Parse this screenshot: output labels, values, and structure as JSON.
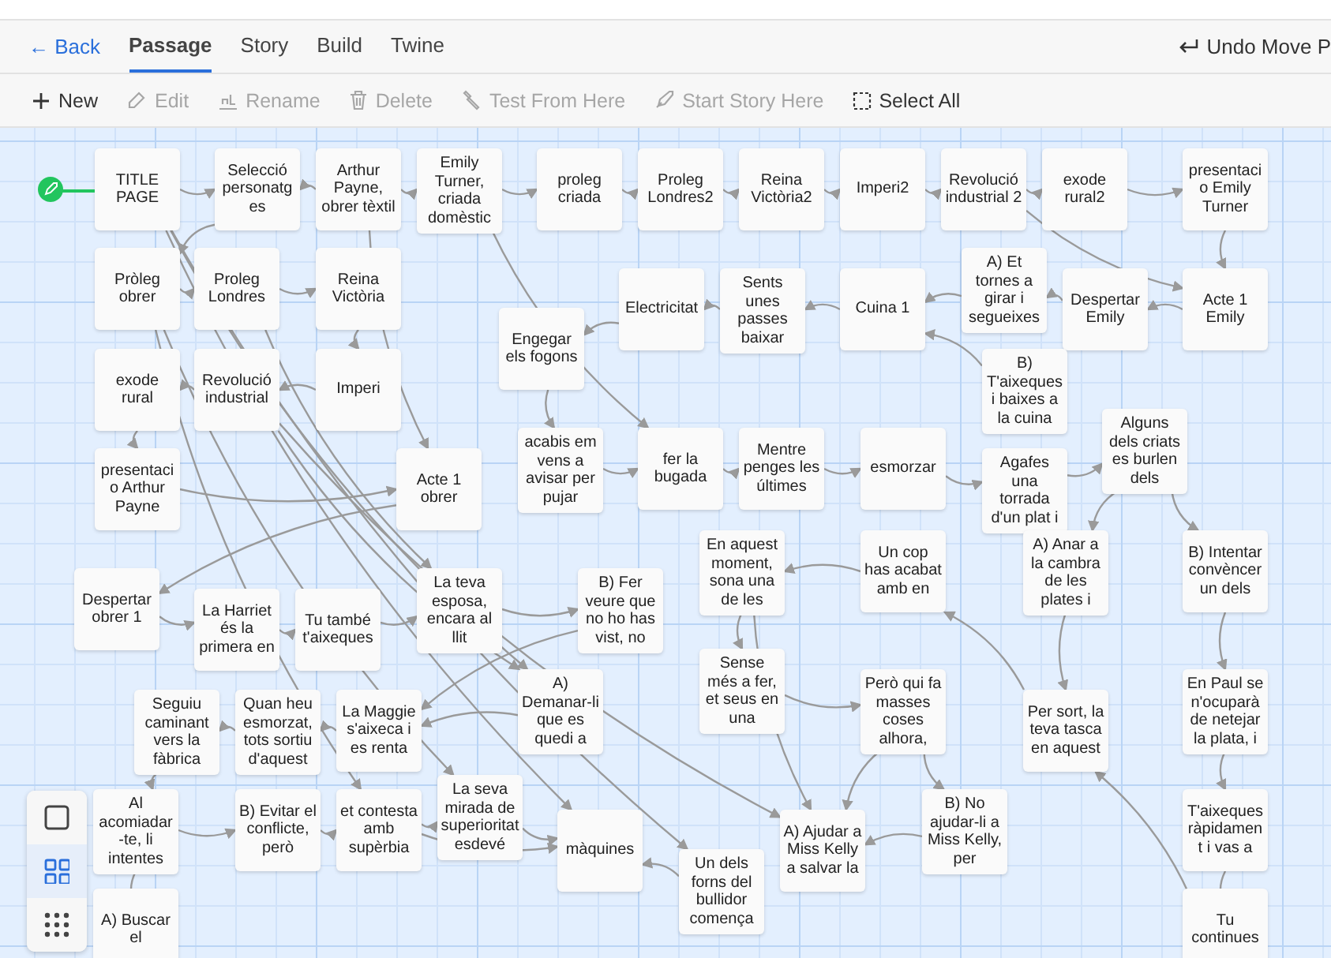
{
  "top_bar": {
    "back": "← Back",
    "tabs": [
      {
        "label": "Passage",
        "selected": true
      },
      {
        "label": "Story",
        "selected": false
      },
      {
        "label": "Build",
        "selected": false
      },
      {
        "label": "Twine",
        "selected": false
      }
    ],
    "undo": "Undo Move P"
  },
  "actions": [
    {
      "label": "New",
      "kind": "new",
      "disabled": false
    },
    {
      "label": "Edit",
      "kind": "edit",
      "disabled": true
    },
    {
      "label": "Rename",
      "kind": "rename",
      "disabled": true
    },
    {
      "label": "Delete",
      "kind": "delete",
      "disabled": true
    },
    {
      "label": "Test From Here",
      "kind": "test",
      "disabled": true
    },
    {
      "label": "Start Story Here",
      "kind": "start",
      "disabled": true
    },
    {
      "label": "Select All",
      "kind": "select",
      "disabled": false
    }
  ],
  "passages": [
    {
      "title": "TITLE PAGE",
      "start": true
    },
    {
      "title": "Selecció personatges",
      "start": false
    },
    {
      "title": "Arthur Payne, obrer tèxtil",
      "start": false
    },
    {
      "title": "Emily Turner, criada domèstic",
      "start": false
    },
    {
      "title": "proleg criada",
      "start": false
    },
    {
      "title": "Proleg Londres2",
      "start": false
    },
    {
      "title": "Reina Victòria2",
      "start": false
    },
    {
      "title": "Imperi2",
      "start": false
    },
    {
      "title": "Revolució industrial 2",
      "start": false
    },
    {
      "title": "exode rural2",
      "start": false
    },
    {
      "title": "presentacio Emily Turner",
      "start": false
    },
    {
      "title": "Pròleg obrer",
      "start": false
    },
    {
      "title": "Proleg Londres",
      "start": false
    },
    {
      "title": "Reina Victòria",
      "start": false
    },
    {
      "title": "Engegar els fogons",
      "start": false
    },
    {
      "title": "Electricitat",
      "start": false
    },
    {
      "title": "Sents unes passes baixar",
      "start": false
    },
    {
      "title": "Cuina 1",
      "start": false
    },
    {
      "title": "A) Et tornes a girar i segueixes",
      "start": false
    },
    {
      "title": "Despertar Emily",
      "start": false
    },
    {
      "title": "Acte 1 Emily",
      "start": false
    },
    {
      "title": "exode rural",
      "start": false
    },
    {
      "title": "Revolució industrial",
      "start": false
    },
    {
      "title": "Imperi",
      "start": false
    },
    {
      "title": "B) T'aixeques i baixes a la cuina",
      "start": false
    },
    {
      "title": "presentacio Arthur Payne",
      "start": false
    },
    {
      "title": "Acte 1 obrer",
      "start": false
    },
    {
      "title": "acabis em vens a avisar per pujar",
      "start": false
    },
    {
      "title": "fer la bugada",
      "start": false
    },
    {
      "title": "Mentre penges les últimes",
      "start": false
    },
    {
      "title": "esmorzar",
      "start": false
    },
    {
      "title": "Agafes una torrada d'un plat i",
      "start": false
    },
    {
      "title": "Alguns dels criats es burlen dels",
      "start": false
    },
    {
      "title": "Despertar obrer 1",
      "start": false
    },
    {
      "title": "La Harriet és la primera en",
      "start": false
    },
    {
      "title": "Tu també t'aixeques",
      "start": false
    },
    {
      "title": "La teva esposa, encara al llit",
      "start": false
    },
    {
      "title": "B) Fer veure que no ho has vist, no",
      "start": false
    },
    {
      "title": "En aquest moment, sona una de les",
      "start": false
    },
    {
      "title": "Un cop has acabat amb en",
      "start": false
    },
    {
      "title": "A) Anar a la cambra de les plates i",
      "start": false
    },
    {
      "title": "B) Intentar convèncer un dels",
      "start": false
    },
    {
      "title": "Seguiu caminant vers la fàbrica",
      "start": false
    },
    {
      "title": "Quan heu esmorzat, tots sortiu d'aquest",
      "start": false
    },
    {
      "title": "La Maggie s'aixeca i es renta",
      "start": false
    },
    {
      "title": "A) Demanar-li que es quedi a",
      "start": false
    },
    {
      "title": "Sense més a fer, et seus en una",
      "start": false
    },
    {
      "title": "Però qui fa masses coses alhora,",
      "start": false
    },
    {
      "title": "Per sort, la teva tasca en aquest",
      "start": false
    },
    {
      "title": "En Paul se n'ocuparà de netejar la plata, i",
      "start": false
    },
    {
      "title": "Al acomiadar-te, li intentes",
      "start": false
    },
    {
      "title": "B) Evitar el conflicte, però",
      "start": false
    },
    {
      "title": "et contesta amb supèrbia",
      "start": false
    },
    {
      "title": "La seva mirada de superioritat esdevé",
      "start": false
    },
    {
      "title": "màquines",
      "start": false
    },
    {
      "title": "Un dels forns del bullidor comença",
      "start": false
    },
    {
      "title": "A) Ajudar a Miss Kelly a salvar la",
      "start": false
    },
    {
      "title": "B) No ajudar-li a Miss Kelly, per",
      "start": false
    },
    {
      "title": "T'aixeques ràpidament i vas a",
      "start": false
    },
    {
      "title": "A) Buscar el",
      "start": false
    },
    {
      "title": "Tu continues",
      "start": false
    }
  ],
  "zoom_buttons": [
    {
      "kind": "single",
      "selected": false
    },
    {
      "kind": "grid",
      "selected": true
    },
    {
      "kind": "dots",
      "selected": false
    }
  ]
}
